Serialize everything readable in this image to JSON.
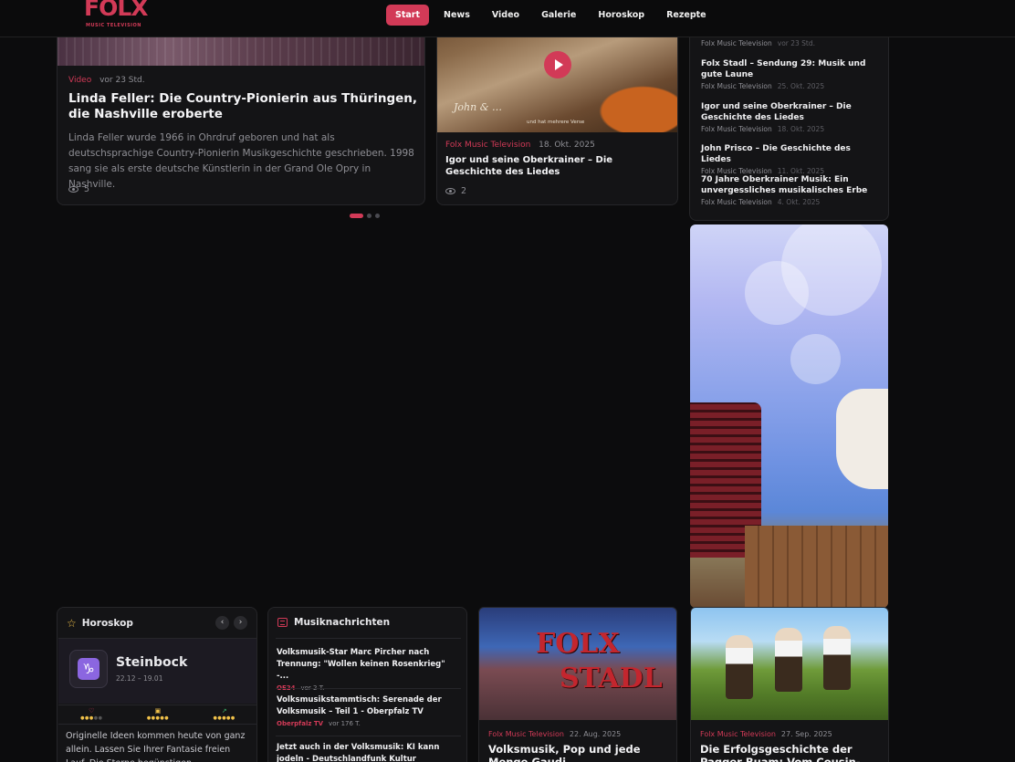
{
  "brand": {
    "name": "FOLX",
    "tagline": "MUSIC TELEVISION",
    "accent": "#d23a57"
  },
  "nav": {
    "items": [
      "Start",
      "News",
      "Video",
      "Galerie",
      "Horoskop",
      "Rezepte"
    ],
    "active": "Start"
  },
  "featured": [
    {
      "category": "Video",
      "time": "vor 23 Std.",
      "title": "Linda Feller: Die Country-Pionierin aus Thüringen, die Nashville eroberte",
      "excerpt": "Linda Feller wurde 1966 in Ohrdruf geboren und hat als deutschsprachige Country-Pionierin Musikgeschichte geschrieben. 1998 sang sie als erste deutsche Künstlerin in der Grand Ole Opry in Nashville.",
      "views": "5"
    },
    {
      "category": "Folx Music Television",
      "time": "18. Okt. 2025",
      "title": "Igor und seine Oberkrainer – Die Geschichte des Liedes",
      "views": "2",
      "image_caption": "und hat mehrere Verse",
      "image_signature": "John & …"
    }
  ],
  "carousel": {
    "pages": 3,
    "active": 0
  },
  "sidebar_list": [
    {
      "title": "",
      "source": "Folx Music Television",
      "date": "vor 23 Std."
    },
    {
      "title": "Folx Stadl – Sendung 29: Musik und gute Laune",
      "source": "Folx Music Television",
      "date": "25. Okt. 2025"
    },
    {
      "title": "Igor und seine Oberkrainer – Die Geschichte des Liedes",
      "source": "Folx Music Television",
      "date": "18. Okt. 2025"
    },
    {
      "title": "John Prisco – Die Geschichte des Liedes",
      "source": "Folx Music Television",
      "date": "11. Okt. 2025"
    },
    {
      "title": "70 Jahre Oberkrainer Musik: Ein unvergessliches musikalisches Erbe",
      "source": "Folx Music Television",
      "date": "4. Okt. 2025"
    }
  ],
  "horoskop": {
    "heading": "Horoskop",
    "sign": "Steinbock",
    "symbol": "♑",
    "dates": "22.12 – 19.01",
    "ratings": {
      "love": 3,
      "money": 5,
      "career": 5
    },
    "text": "Originelle Ideen kommen heute von ganz allein. Lassen Sie Ihrer Fantasie freien Lauf. Die Sterne begünstigen unkonventionelles"
  },
  "musik": {
    "heading": "Musiknachrichten",
    "items": [
      {
        "title": "Volksmusik-Star Marc Pircher nach Trennung: \"Wollen keinen Rosenkrieg\" -...",
        "source": "OE24",
        "ago": "vor 2 T."
      },
      {
        "title": "Volksmusikstammtisch: Serenade der Volksmusik – Teil 1 - Oberpfalz TV",
        "source": "Oberpfalz TV",
        "ago": "vor 176 T."
      },
      {
        "title": "Jetzt auch in der Volksmusik: KI kann jodeln - Deutschlandfunk Kultur",
        "source": "",
        "ago": ""
      }
    ]
  },
  "articles": [
    {
      "category": "Folx Music Television",
      "date": "22. Aug. 2025",
      "title": "Volksmusik, Pop und jede Menge Gaudi",
      "image_text": [
        "FOLX",
        "STADL"
      ]
    },
    {
      "category": "Folx Music Television",
      "date": "27. Sep. 2025",
      "title": "Die Erfolgsgeschichte der Pagger Buam: Vom Cousin-Duo zum"
    }
  ]
}
